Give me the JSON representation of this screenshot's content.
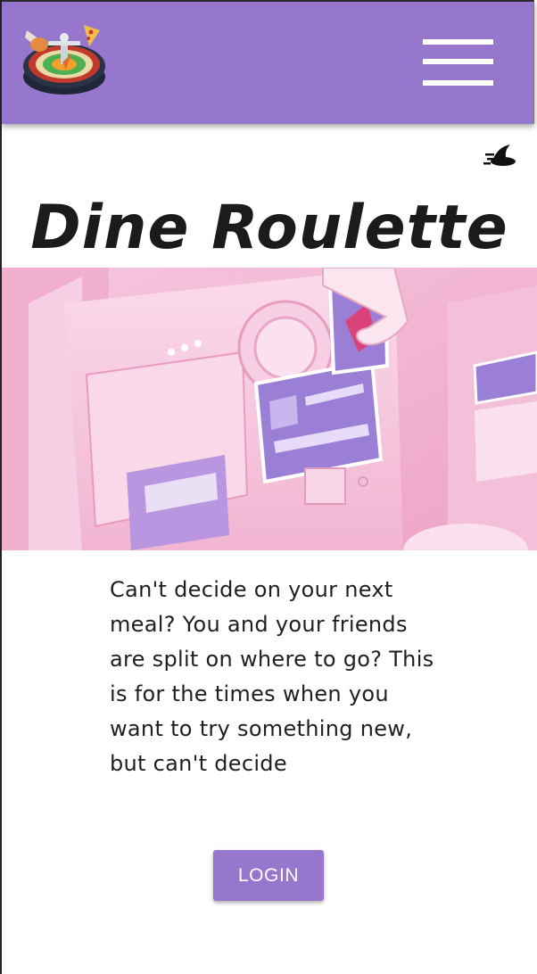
{
  "header": {
    "background_color": "#9777cd",
    "logo_icon": "roulette-food-logo-icon",
    "menu_icon": "hamburger-menu-icon"
  },
  "theme_toggle": {
    "icon": "witch-hat-icon"
  },
  "main": {
    "title": "Dine Roulette",
    "hero_image": "gashapon-capsule-machine-illustration",
    "description": "Can't decide on your next meal? You and your friends are split on where to go? This is for the times when you want to try something new, but can't decide",
    "login_label": "LOGIN"
  },
  "colors": {
    "accent": "#9777cd",
    "hero_pink": "#f3b9d6",
    "machine_purple": "#9b7fd6",
    "text": "#1b1b1b"
  }
}
